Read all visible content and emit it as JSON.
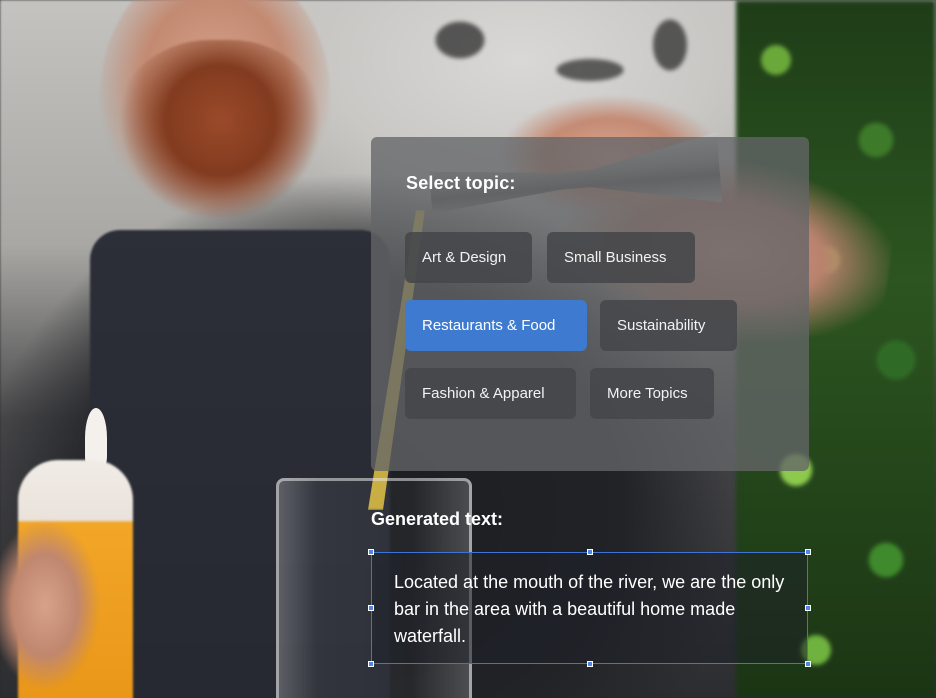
{
  "topic_panel": {
    "title": "Select topic:",
    "topics": [
      {
        "label": "Art & Design",
        "selected": false
      },
      {
        "label": "Small Business",
        "selected": false
      },
      {
        "label": "Restaurants & Food",
        "selected": true
      },
      {
        "label": "Sustainability",
        "selected": false
      },
      {
        "label": "Fashion & Apparel",
        "selected": false
      },
      {
        "label": "More Topics",
        "selected": false
      }
    ]
  },
  "generated": {
    "label": "Generated text:",
    "text": "Located at the mouth of the river, we are the only bar in the area with a beautiful home made waterfall."
  },
  "colors": {
    "selected_chip": "#3d7ad0",
    "chip": "#46474a",
    "panel": "#646568",
    "selection_border": "#3f74d6"
  }
}
